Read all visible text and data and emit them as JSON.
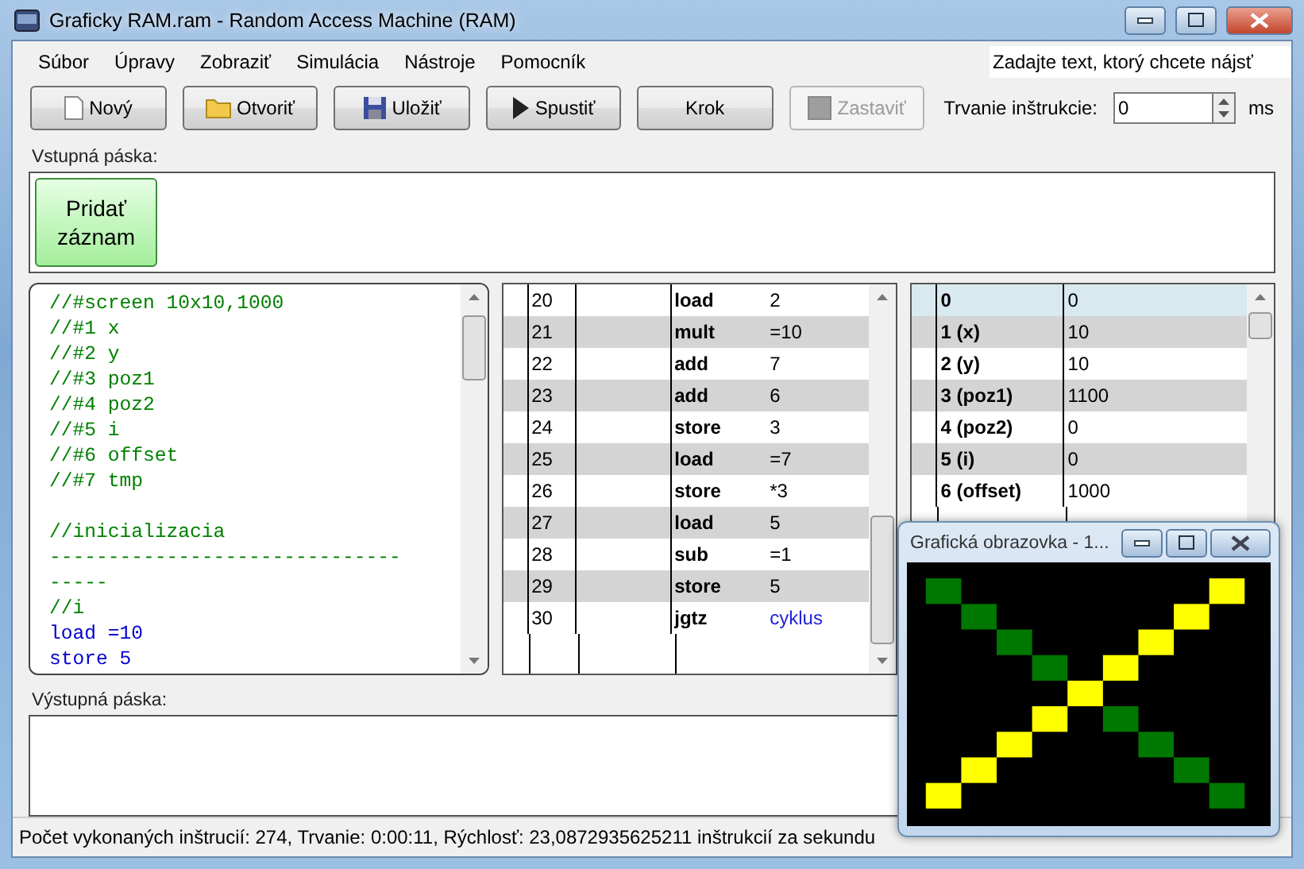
{
  "window": {
    "title": "Graficky RAM.ram - Random Access Machine (RAM)"
  },
  "menu": [
    "Súbor",
    "Úpravy",
    "Zobraziť",
    "Simulácia",
    "Nástroje",
    "Pomocník"
  ],
  "search": {
    "placeholder": "Zadajte text, ktorý chcete nájsť"
  },
  "toolbar": [
    {
      "label": "Nový",
      "kind": "page",
      "disabled": false
    },
    {
      "label": "Otvoriť",
      "kind": "folder",
      "disabled": false
    },
    {
      "label": "Uložiť",
      "kind": "floppy",
      "disabled": false
    },
    {
      "label": "Spustiť",
      "kind": "play",
      "disabled": false
    },
    {
      "label": "Krok",
      "kind": "plain",
      "disabled": false
    },
    {
      "label": "Zastaviť",
      "kind": "stop",
      "disabled": true
    }
  ],
  "duration": {
    "label": "Trvanie inštrukcie:",
    "value": "0",
    "unit": "ms"
  },
  "input_tape": {
    "label": "Vstupná páska:",
    "add_button": "Pridať záznam"
  },
  "code": [
    {
      "text": "//#screen 10x10,1000",
      "kind": "comment"
    },
    {
      "text": "//#1 x",
      "kind": "comment"
    },
    {
      "text": "//#2 y",
      "kind": "comment"
    },
    {
      "text": "//#3 poz1",
      "kind": "comment"
    },
    {
      "text": "//#4 poz2",
      "kind": "comment"
    },
    {
      "text": "//#5 i",
      "kind": "comment"
    },
    {
      "text": "//#6 offset",
      "kind": "comment"
    },
    {
      "text": "//#7 tmp",
      "kind": "comment"
    },
    {
      "kind": "blank"
    },
    {
      "text": "//inicializacia",
      "kind": "comment"
    },
    {
      "text": "------------------------------",
      "kind": "comment"
    },
    {
      "text": "-----",
      "kind": "comment"
    },
    {
      "text": "//i",
      "kind": "comment"
    },
    {
      "text": "load =10",
      "kind": "code"
    },
    {
      "text": "store 5",
      "kind": "code"
    }
  ],
  "program": [
    {
      "line": "20",
      "instruction": "load",
      "operand": "2",
      "kind": "value"
    },
    {
      "line": "21",
      "instruction": "mult",
      "operand": "=10",
      "kind": "value"
    },
    {
      "line": "22",
      "instruction": "add",
      "operand": "7",
      "kind": "value"
    },
    {
      "line": "23",
      "instruction": "add",
      "operand": "6",
      "kind": "value"
    },
    {
      "line": "24",
      "instruction": "store",
      "operand": "3",
      "kind": "value"
    },
    {
      "line": "25",
      "instruction": "load",
      "operand": "=7",
      "kind": "value"
    },
    {
      "line": "26",
      "instruction": "store",
      "operand": "*3",
      "kind": "value"
    },
    {
      "line": "27",
      "instruction": "load",
      "operand": "5",
      "kind": "value"
    },
    {
      "line": "28",
      "instruction": "sub",
      "operand": "=1",
      "kind": "value"
    },
    {
      "line": "29",
      "instruction": "store",
      "operand": "5",
      "kind": "value"
    },
    {
      "line": "30",
      "instruction": "jgtz",
      "operand": "cyklus",
      "kind": "label"
    }
  ],
  "memory": [
    {
      "register": "0",
      "value": "0",
      "selected": true
    },
    {
      "register": "1 (x)",
      "value": "10",
      "selected": false
    },
    {
      "register": "2 (y)",
      "value": "10",
      "selected": false
    },
    {
      "register": "3 (poz1)",
      "value": "1100",
      "selected": false
    },
    {
      "register": "4 (poz2)",
      "value": "0",
      "selected": false
    },
    {
      "register": "5 (i)",
      "value": "0",
      "selected": false
    },
    {
      "register": "6 (offset)",
      "value": "1000",
      "selected": false
    }
  ],
  "output_tape": {
    "label": "Výstupná páska:"
  },
  "status_bar": "Počet vykonaných inštrucií: 274, Trvanie: 0:00:11, Rýchlosť: 23,0872935625211 inštrukcií za sekundu",
  "screen_window": {
    "title": "Grafická obrazovka - 1..."
  }
}
